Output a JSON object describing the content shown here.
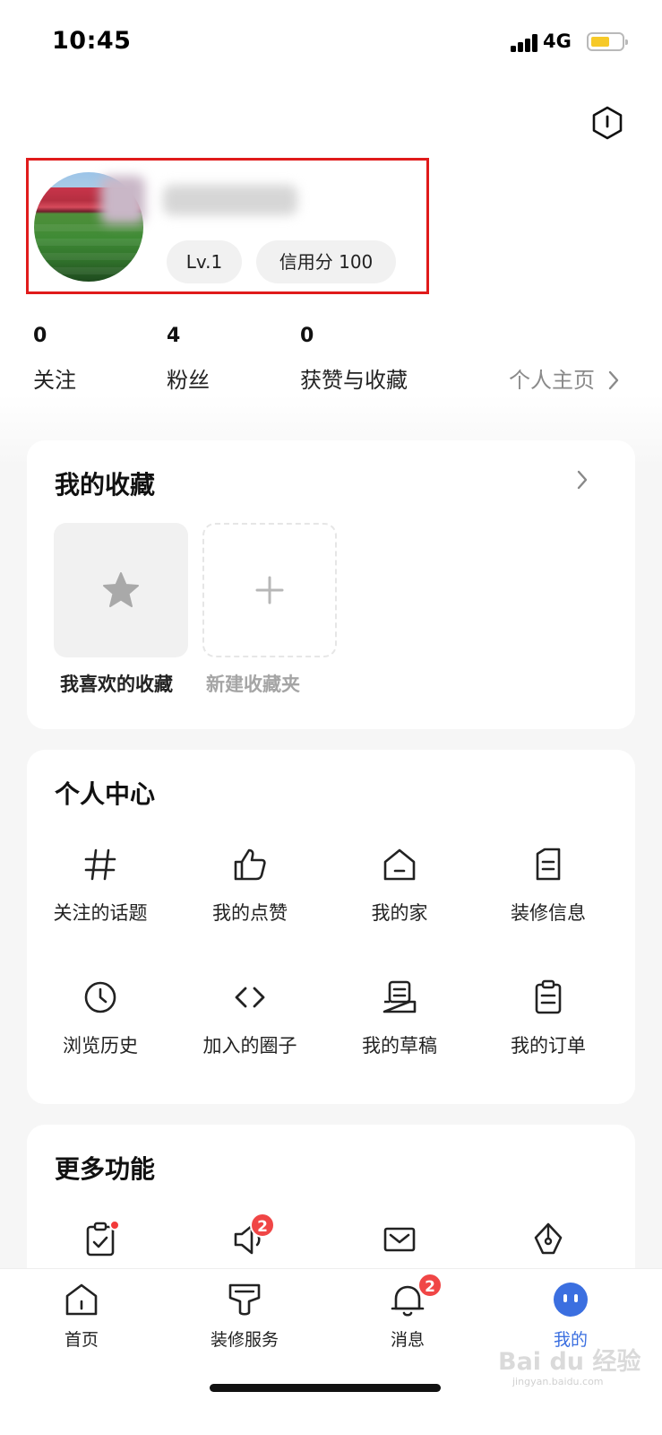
{
  "status_bar": {
    "time": "10:45",
    "network": "4G",
    "battery_color": "#f6c928"
  },
  "profile": {
    "level": "Lv.1",
    "credit": "信用分 100",
    "highlight_color": "#e01b1b"
  },
  "stats": [
    {
      "value": "0",
      "label": "关注"
    },
    {
      "value": "4",
      "label": "粉丝"
    },
    {
      "value": "0",
      "label": "获赞与收藏"
    }
  ],
  "profile_link": "个人主页",
  "favorites": {
    "title": "我的收藏",
    "items": [
      {
        "label": "我喜欢的收藏",
        "icon": "star-icon"
      },
      {
        "label": "新建收藏夹",
        "icon": "plus-icon"
      }
    ]
  },
  "personal_center": {
    "title": "个人中心",
    "items": [
      {
        "label": "关注的话题",
        "icon": "hashtag-icon"
      },
      {
        "label": "我的点赞",
        "icon": "thumbs-up-icon"
      },
      {
        "label": "我的家",
        "icon": "house-icon"
      },
      {
        "label": "装修信息",
        "icon": "document-icon"
      },
      {
        "label": "浏览历史",
        "icon": "clock-icon"
      },
      {
        "label": "加入的圈子",
        "icon": "code-brackets-icon"
      },
      {
        "label": "我的草稿",
        "icon": "draft-tray-icon"
      },
      {
        "label": "我的订单",
        "icon": "clipboard-icon"
      }
    ]
  },
  "more_features": {
    "title": "更多功能",
    "items": [
      {
        "icon": "clipboard-check-icon",
        "dot": true
      },
      {
        "icon": "speaker-icon",
        "badge": "2"
      },
      {
        "icon": "mail-icon"
      },
      {
        "icon": "pen-nib-icon"
      }
    ]
  },
  "tab_bar": {
    "active_color": "#3b6fe0",
    "tabs": [
      {
        "label": "首页",
        "icon": "home-icon"
      },
      {
        "label": "装修服务",
        "icon": "paint-roller-icon"
      },
      {
        "label": "消息",
        "icon": "bell-icon",
        "badge": "2"
      },
      {
        "label": "我的",
        "icon": "mine-face-icon",
        "active": true
      }
    ]
  },
  "watermark": {
    "text": "Bai du 经验",
    "sub": "jingyan.baidu.com"
  }
}
